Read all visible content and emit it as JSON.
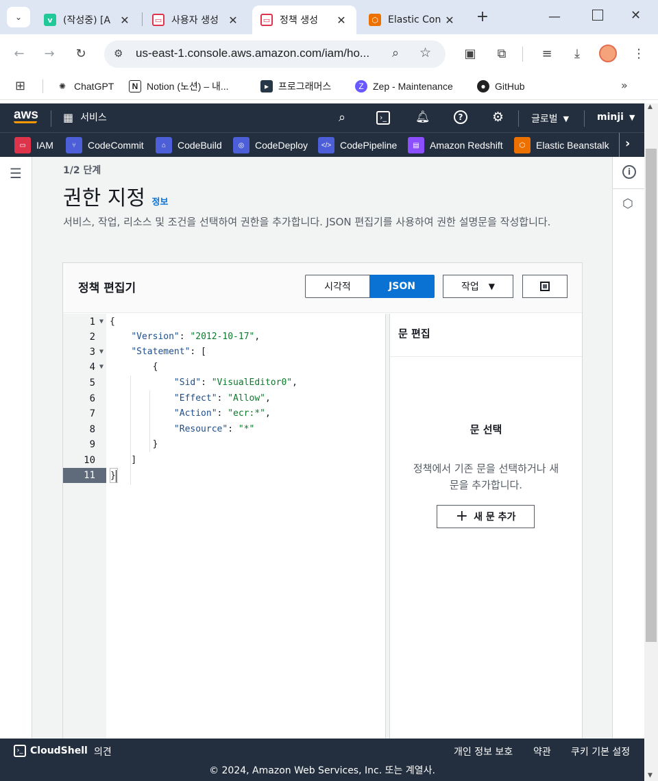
{
  "browser": {
    "tabs": [
      {
        "title": "(작성중) [A",
        "icon": "velog-icon"
      },
      {
        "title": "사용자 생성",
        "icon": "iam-icon"
      },
      {
        "title": "정책 생성",
        "icon": "iam-icon"
      },
      {
        "title": "Elastic Con",
        "icon": "elastic-beanstalk-icon"
      }
    ],
    "url": "us-east-1.console.aws.amazon.com/iam/ho...",
    "bookmarks": [
      {
        "label": "ChatGPT"
      },
      {
        "label": "Notion (노션) – 내..."
      },
      {
        "label": "프로그래머스"
      },
      {
        "label": "Zep - Maintenance"
      },
      {
        "label": "GitHub"
      }
    ]
  },
  "aws_nav": {
    "logo": "aws",
    "services": "서비스",
    "region": "글로벌",
    "user": "minji",
    "favorites": [
      {
        "label": "IAM",
        "color": "#dd344c"
      },
      {
        "label": "CodeCommit",
        "color": "#4d5fd8"
      },
      {
        "label": "CodeBuild",
        "color": "#4d5fd8"
      },
      {
        "label": "CodeDeploy",
        "color": "#4d5fd8"
      },
      {
        "label": "CodePipeline",
        "color": "#4d5fd8"
      },
      {
        "label": "Amazon Redshift",
        "color": "#8c4fff"
      },
      {
        "label": "Elastic Beanstalk",
        "color": "#ed7100"
      }
    ]
  },
  "page": {
    "step": "1/2 단계",
    "title": "권한 지정",
    "info_link": "정보",
    "description": "서비스, 작업, 리소스 및 조건을 선택하여 권한을 추가합니다. JSON 편집기를 사용하여 권한 설명문을 작성합니다."
  },
  "panel": {
    "title": "정책 편집기",
    "toggle_visual": "시각적",
    "toggle_json": "JSON",
    "actions": "작업",
    "line_numbers": [
      "1",
      "2",
      "3",
      "4",
      "5",
      "6",
      "7",
      "8",
      "9",
      "10",
      "11"
    ],
    "code": {
      "l1": "{",
      "version_key": "\"Version\"",
      "version_val": "\"2012-10-17\"",
      "statement_key": "\"Statement\"",
      "l3_tail": ": [",
      "l4": "{",
      "sid_key": "\"Sid\"",
      "sid_val": "\"VisualEditor0\"",
      "effect_key": "\"Effect\"",
      "effect_val": "\"Allow\"",
      "action_key": "\"Action\"",
      "action_val": "\"ecr:*\"",
      "resource_key": "\"Resource\"",
      "resource_val": "\"*\"",
      "l9": "}",
      "l10": "]",
      "l11": "}"
    },
    "side": {
      "title": "문 편집",
      "empty_title": "문 선택",
      "empty_desc_1": "정책에서 기존 문을 선택하거나 새",
      "empty_desc_2": "문을 추가합니다.",
      "add_button": "새 문 추가"
    }
  },
  "footer": {
    "cloudshell": "CloudShell",
    "feedback": "의견",
    "privacy": "개인 정보 보호",
    "terms": "약관",
    "cookies": "쿠키 기본 설정",
    "copyright": "© 2024, Amazon Web Services, Inc. 또는 계열사."
  }
}
